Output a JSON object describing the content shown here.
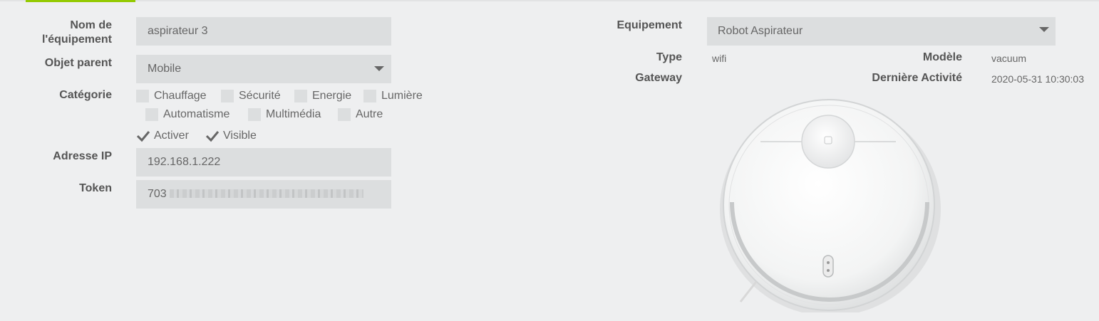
{
  "form": {
    "name_label": "Nom de l'équipement",
    "name_value": "aspirateur 3",
    "parent_label": "Objet parent",
    "parent_value": "Mobile",
    "category_label": "Catégorie",
    "categories": [
      "Chauffage",
      "Sécurité",
      "Energie",
      "Lumière",
      "Automatisme",
      "Multimédia",
      "Autre"
    ],
    "activate_label": "Activer",
    "visible_label": "Visible",
    "ip_label": "Adresse IP",
    "ip_value": "192.168.1.222",
    "token_label": "Token",
    "token_value": "703"
  },
  "device": {
    "equipment_label": "Equipement",
    "equipment_value": "Robot Aspirateur",
    "type_label": "Type",
    "type_value": "wifi",
    "model_label": "Modèle",
    "model_value": "vacuum",
    "gateway_label": "Gateway",
    "gateway_value": "",
    "activity_label": "Dernière Activité",
    "activity_value": "2020-05-31 10:30:03"
  },
  "colors": {
    "accent": "#94ca02",
    "field_bg": "#dcdedf",
    "page_bg": "#eeeff0"
  }
}
